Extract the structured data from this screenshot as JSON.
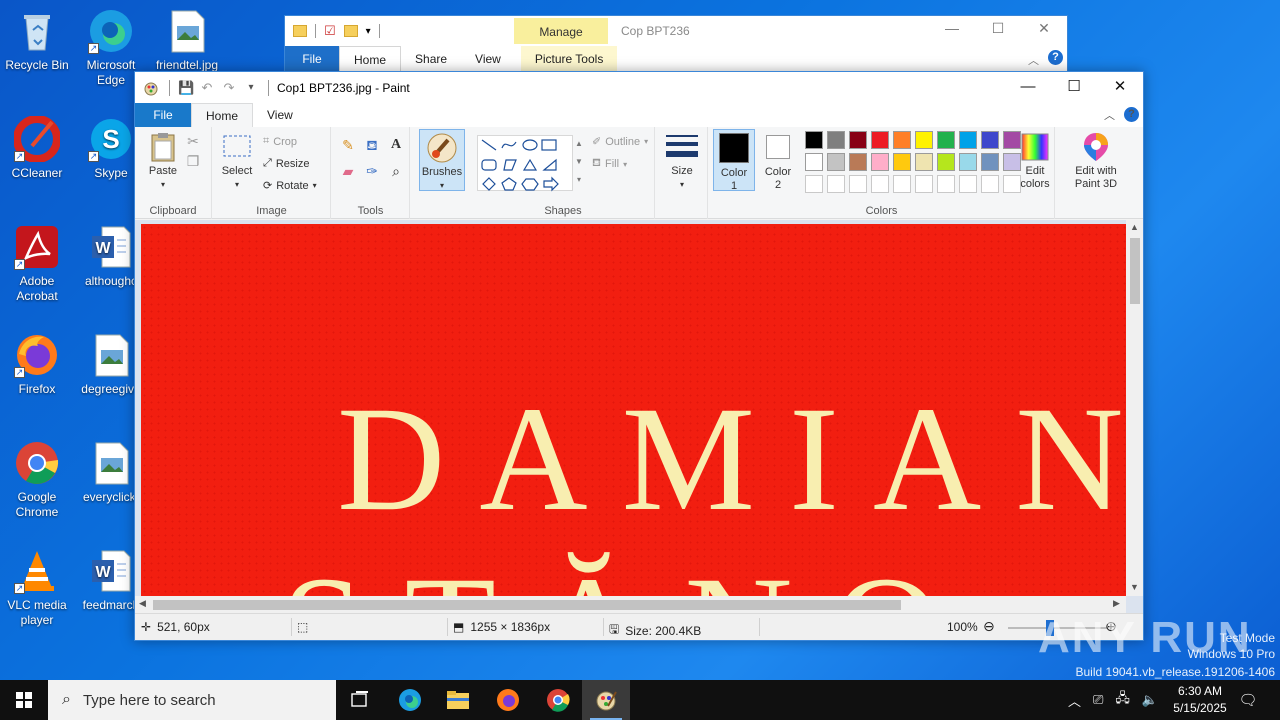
{
  "desktop": {
    "icons": [
      {
        "label": "Recycle Bin"
      },
      {
        "label": "Microsoft Edge"
      },
      {
        "label": "friendtel.jpg"
      },
      {
        "label": "CCleaner"
      },
      {
        "label": "Skype"
      },
      {
        "label": "Adobe Acrobat"
      },
      {
        "label": "althoughc"
      },
      {
        "label": "Firefox"
      },
      {
        "label": "degreegive"
      },
      {
        "label": "Google Chrome"
      },
      {
        "label": "everyclick."
      },
      {
        "label": "VLC media player"
      },
      {
        "label": "feedmarch"
      }
    ]
  },
  "explorer": {
    "manage_label": "Manage",
    "title": "Cop BPT236",
    "tabs": [
      "File",
      "Home",
      "Share",
      "View",
      "Picture Tools"
    ]
  },
  "paint": {
    "title": "Cop1 BPT236.jpg - Paint",
    "tabs": [
      "File",
      "Home",
      "View"
    ],
    "clipboard": {
      "paste": "Paste",
      "group": "Clipboard"
    },
    "image": {
      "select": "Select",
      "crop": "Crop",
      "resize": "Resize",
      "rotate": "Rotate",
      "group": "Image"
    },
    "tools": {
      "group": "Tools"
    },
    "brushes": "Brushes",
    "shapes": {
      "outline": "Outline",
      "fill": "Fill",
      "group": "Shapes"
    },
    "size": "Size",
    "colors": {
      "color1": "Color\n1",
      "color1_l1": "Color",
      "color1_l2": "1",
      "color2_l1": "Color",
      "color2_l2": "2",
      "edit_l1": "Edit",
      "edit_l2": "colors",
      "group": "Colors",
      "palette_row1": [
        "#000000",
        "#7f7f7f",
        "#880015",
        "#ed1c24",
        "#ff7f27",
        "#fff200",
        "#22b14c",
        "#00a2e8",
        "#3f48cc",
        "#a349a4"
      ],
      "palette_row2": [
        "#ffffff",
        "#c3c3c3",
        "#b97a57",
        "#ffaec9",
        "#ffc90e",
        "#efe4b0",
        "#b5e61d",
        "#99d9ea",
        "#7092be",
        "#c8bfe7"
      ]
    },
    "paint3d_l1": "Edit with",
    "paint3d_l2": "Paint 3D",
    "canvas": {
      "line1": "DAMIAN",
      "line2": "STĂNO"
    },
    "status": {
      "cursor": "521, 60px",
      "dimensions": "1255 × 1836px",
      "size": "Size: 200.4KB",
      "zoom": "100%"
    }
  },
  "watermark": {
    "brand": "ANY RUN",
    "line1": "Test Mode",
    "line2": "Windows 10 Pro",
    "line3": "Build 19041.vb_release.191206-1406"
  },
  "taskbar": {
    "search_placeholder": "Type here to search",
    "time": "6:30 AM",
    "date": "5/15/2025"
  }
}
